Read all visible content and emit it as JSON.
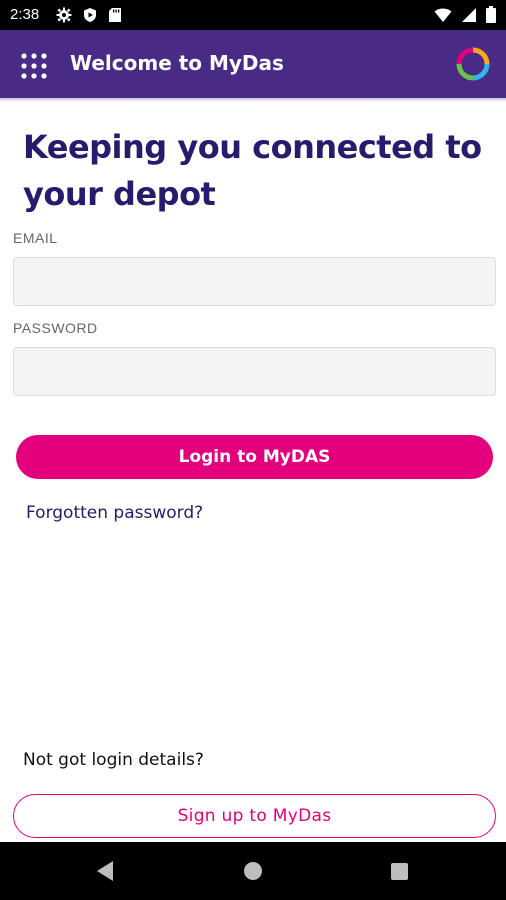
{
  "status_bar": {
    "time": "2:38",
    "left_icons": [
      "gear-icon",
      "play-shield-icon",
      "sd-card-icon"
    ],
    "right_icons": [
      "wifi-icon",
      "cell-signal-icon",
      "battery-icon"
    ]
  },
  "app_bar": {
    "title": "Welcome to MyDas",
    "background": "#492b86",
    "menu_icon": "apps-grid-icon",
    "logo_icon": "mydas-ring-logo"
  },
  "login": {
    "headline": "Keeping you connected to your depot",
    "email_label": "EMAIL",
    "email_value": "",
    "password_label": "PASSWORD",
    "password_value": "",
    "login_button_label": "Login to MyDAS",
    "forgot_password_link": "Forgotten password?"
  },
  "signup": {
    "prompt": "Not got login details?",
    "button_label": "Sign up to MyDas"
  },
  "colors": {
    "primary": "#492b86",
    "accent": "#e4007c",
    "heading": "#271b6e"
  },
  "nav_bar": {
    "icons": [
      "back-icon",
      "home-icon",
      "recents-icon"
    ]
  }
}
